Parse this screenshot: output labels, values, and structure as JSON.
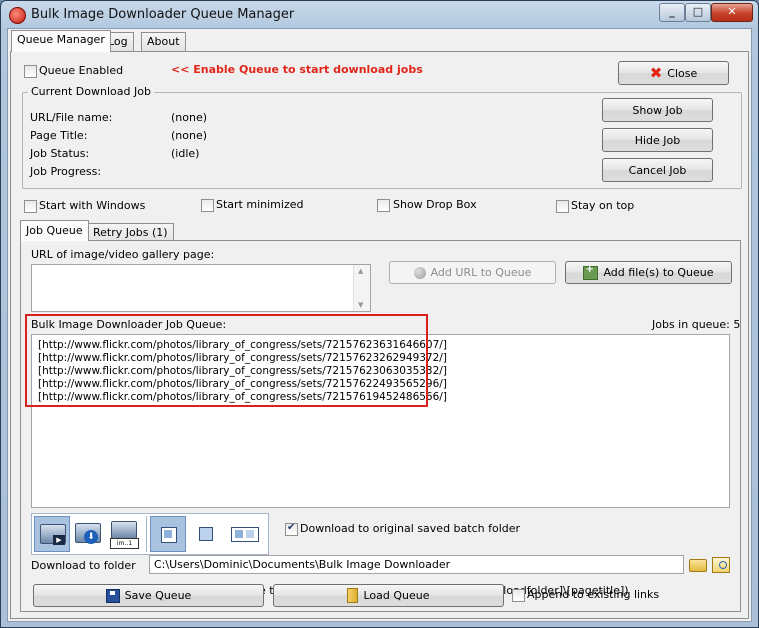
{
  "window": {
    "title": "Bulk Image Downloader Queue Manager"
  },
  "tabs": [
    "Queue Manager",
    "Log",
    "About"
  ],
  "queue_enabled": {
    "label": "Queue Enabled",
    "checked": false,
    "hint": "<< Enable Queue to start download jobs"
  },
  "close_label": "Close",
  "current_job": {
    "title": "Current Download Job",
    "fields": [
      {
        "label": "URL/File name:",
        "value": "(none)"
      },
      {
        "label": "Page Title:",
        "value": "(none)"
      },
      {
        "label": "Job Status:",
        "value": "(idle)"
      },
      {
        "label": "Job Progress:",
        "value": ""
      }
    ],
    "buttons": {
      "show": "Show Job",
      "hide": "Hide Job",
      "cancel": "Cancel Job"
    }
  },
  "options": {
    "start_windows": "Start with Windows",
    "start_minimized": "Start minimized",
    "show_drop_box": "Show Drop Box",
    "stay_on_top": "Stay on top"
  },
  "inner_tabs": [
    "Job Queue",
    "Retry Jobs (1)"
  ],
  "url_box_label": "URL of image/video gallery page:",
  "add_url_label": "Add URL to Queue",
  "add_files_label": "Add file(s) to Queue",
  "queue": {
    "label": "Bulk Image Downloader Job Queue:",
    "count_text": "Jobs in queue: 5",
    "items": [
      "[http://www.flickr.com/photos/library_of_congress/sets/72157623631646607/]",
      "[http://www.flickr.com/photos/library_of_congress/sets/72157623262949372/]",
      "[http://www.flickr.com/photos/library_of_congress/sets/72157623063035332/]",
      "[http://www.flickr.com/photos/library_of_congress/sets/72157622493565296/]",
      "[http://www.flickr.com/photos/library_of_congress/sets/72157619452486566/]"
    ]
  },
  "toolbar_icon_text": "im..1",
  "download_original_label": "Download to original saved batch folder",
  "download_folder": {
    "label": "Download to folder",
    "value": "C:\\Users\\Dominic\\Documents\\Bulk Image Downloader"
  },
  "save_subfolder_label": "Save to web page title subfolder (files will be saved to [downloadfolder]\\[pagetitle])",
  "save_queue_label": "Save Queue",
  "load_queue_label": "Load Queue",
  "append_label": "Append to existing links",
  "colors": {
    "hint_red": "#e0261a",
    "highlight_red": "#d9221d",
    "toolbar_blue": "#a8c2e0"
  }
}
